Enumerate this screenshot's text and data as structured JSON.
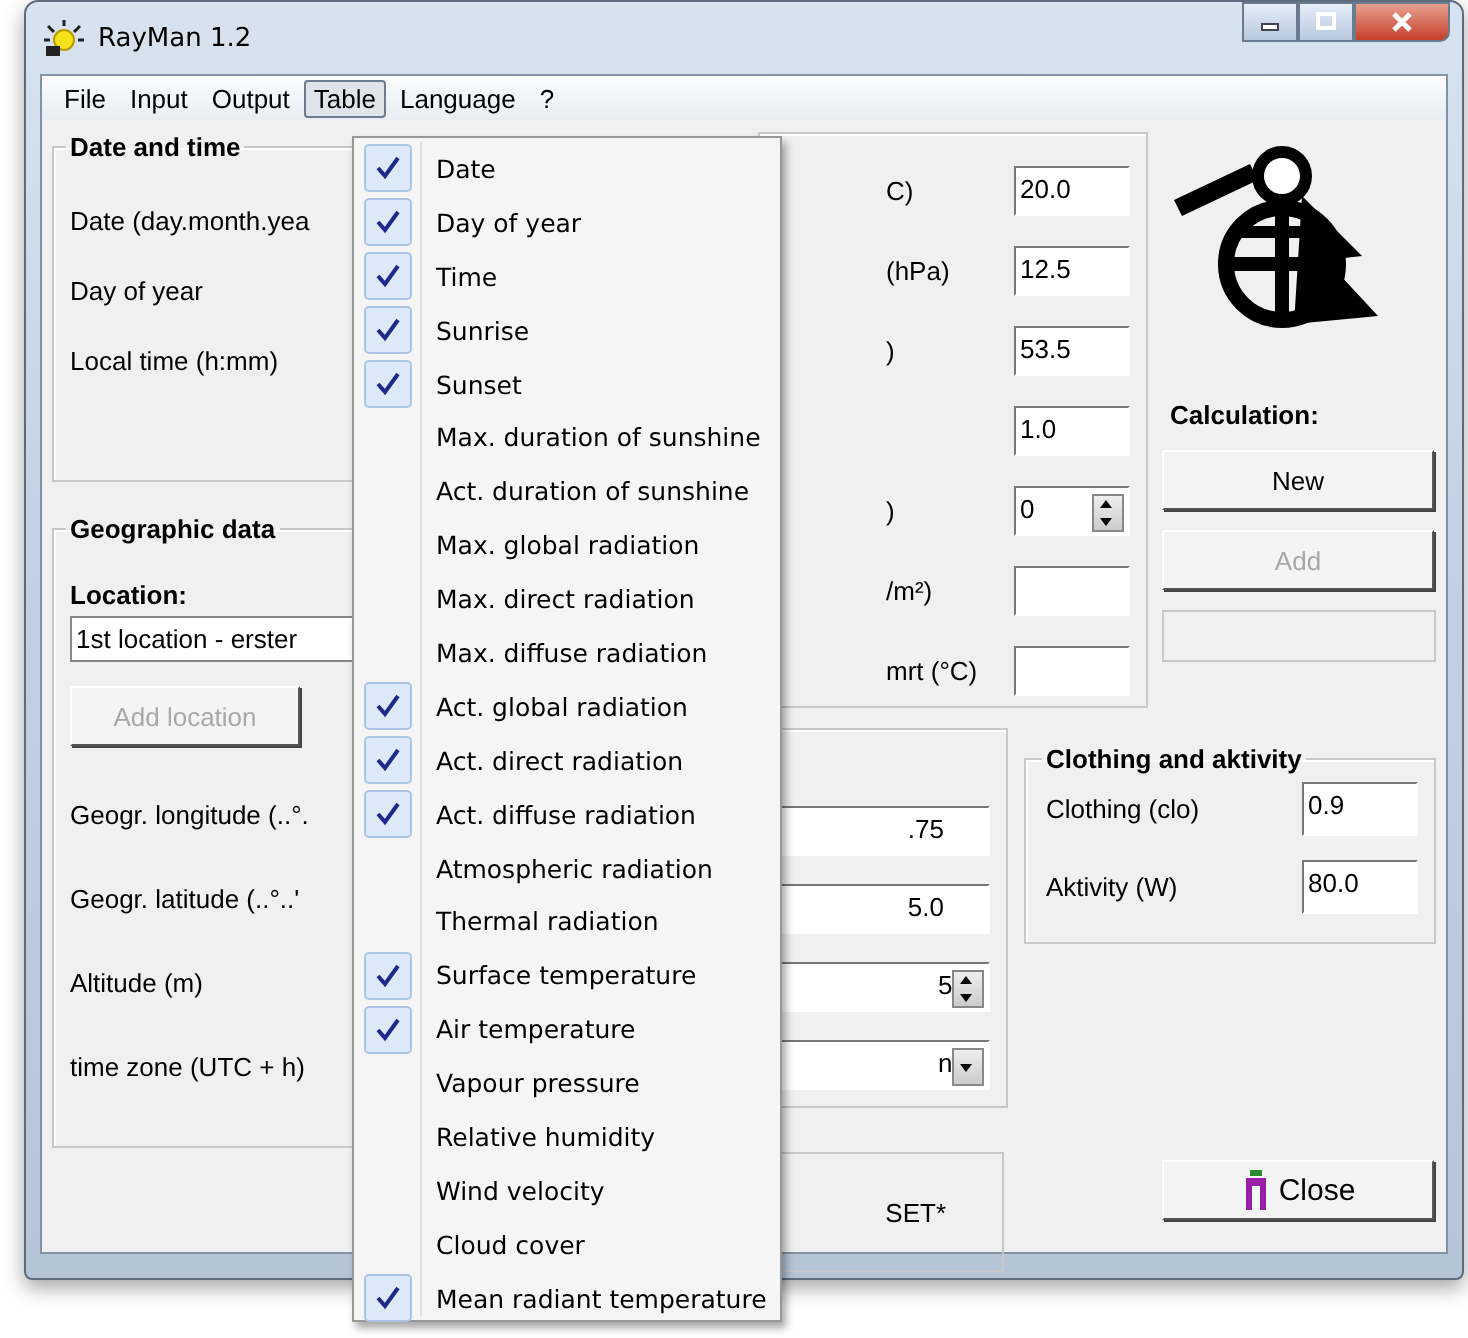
{
  "window": {
    "title": "RayMan 1.2"
  },
  "menu_bar": [
    {
      "label": "File",
      "selected": false
    },
    {
      "label": "Input",
      "selected": false
    },
    {
      "label": "Output",
      "selected": false
    },
    {
      "label": "Table",
      "selected": true
    },
    {
      "label": "Language",
      "selected": false
    },
    {
      "label": "?",
      "selected": false
    }
  ],
  "table_menu": [
    {
      "label": "Date",
      "checked": true
    },
    {
      "label": "Day of year",
      "checked": true
    },
    {
      "label": "Time",
      "checked": true
    },
    {
      "label": "Sunrise",
      "checked": true
    },
    {
      "label": "Sunset",
      "checked": true
    },
    {
      "label": "Max. duration of sunshine",
      "checked": false
    },
    {
      "label": "Act. duration of sunshine",
      "checked": false
    },
    {
      "label": "Max. global radiation",
      "checked": false
    },
    {
      "label": "Max. direct radiation",
      "checked": false
    },
    {
      "label": "Max. diffuse radiation",
      "checked": false
    },
    {
      "label": "Act. global radiation",
      "checked": true
    },
    {
      "label": "Act. direct radiation",
      "checked": true
    },
    {
      "label": "Act. diffuse radiation",
      "checked": true
    },
    {
      "label": "Atmospheric radiation",
      "checked": false
    },
    {
      "label": "Thermal radiation",
      "checked": false
    },
    {
      "label": "Surface temperature",
      "checked": true
    },
    {
      "label": "Air temperature",
      "checked": true
    },
    {
      "label": "Vapour pressure",
      "checked": false
    },
    {
      "label": "Relative humidity",
      "checked": false
    },
    {
      "label": "Wind velocity",
      "checked": false
    },
    {
      "label": "Cloud cover",
      "checked": false
    },
    {
      "label": "Mean radiant temperature",
      "checked": true
    }
  ],
  "date_and_time": {
    "title": "Date and time",
    "rows": [
      "Date (day.month.yea",
      "Day of year",
      "Local time (h:mm)"
    ]
  },
  "geographic_data": {
    "title": "Geographic data",
    "location_label": "Location:",
    "location_value": "1st location - erster",
    "add_location": {
      "label": "Add location",
      "disabled": true
    },
    "rows": [
      "Geogr. longitude (..°.",
      "Geogr. latitude (..°..'",
      "Altitude (m)",
      "time zone (UTC + h)"
    ]
  },
  "meteorological": [
    {
      "label": "C)",
      "value": "20.0",
      "kind": "input"
    },
    {
      "label": "(hPa)",
      "value": "12.5",
      "kind": "input"
    },
    {
      "label": ")",
      "value": "53.5",
      "kind": "input"
    },
    {
      "value": "1.0",
      "kind": "input"
    },
    {
      "label": ")",
      "value": "0",
      "kind": "spinner"
    },
    {
      "label": "/m²)",
      "kind": "input"
    },
    {
      "label": "mrt (°C)",
      "kind": "input"
    }
  ],
  "location_values": [
    {
      "value": ".75",
      "kind": "input"
    },
    {
      "value": "5.0",
      "kind": "input"
    },
    {
      "value": "5",
      "kind": "spinner"
    },
    {
      "value": "n",
      "kind": "dropdown"
    }
  ],
  "set_box": {
    "text": "SET*"
  },
  "calculation": {
    "title": "Calculation:",
    "buttons": [
      {
        "label": "New",
        "disabled": false
      },
      {
        "label": "Add",
        "disabled": true
      }
    ]
  },
  "clothing_and_activity": {
    "title": "Clothing and aktivity",
    "rows": [
      {
        "label": "Clothing (clo)",
        "value": "0.9"
      },
      {
        "label": "Aktivity (W)",
        "value": "80.0"
      }
    ]
  },
  "close_button": {
    "label": "Close"
  }
}
